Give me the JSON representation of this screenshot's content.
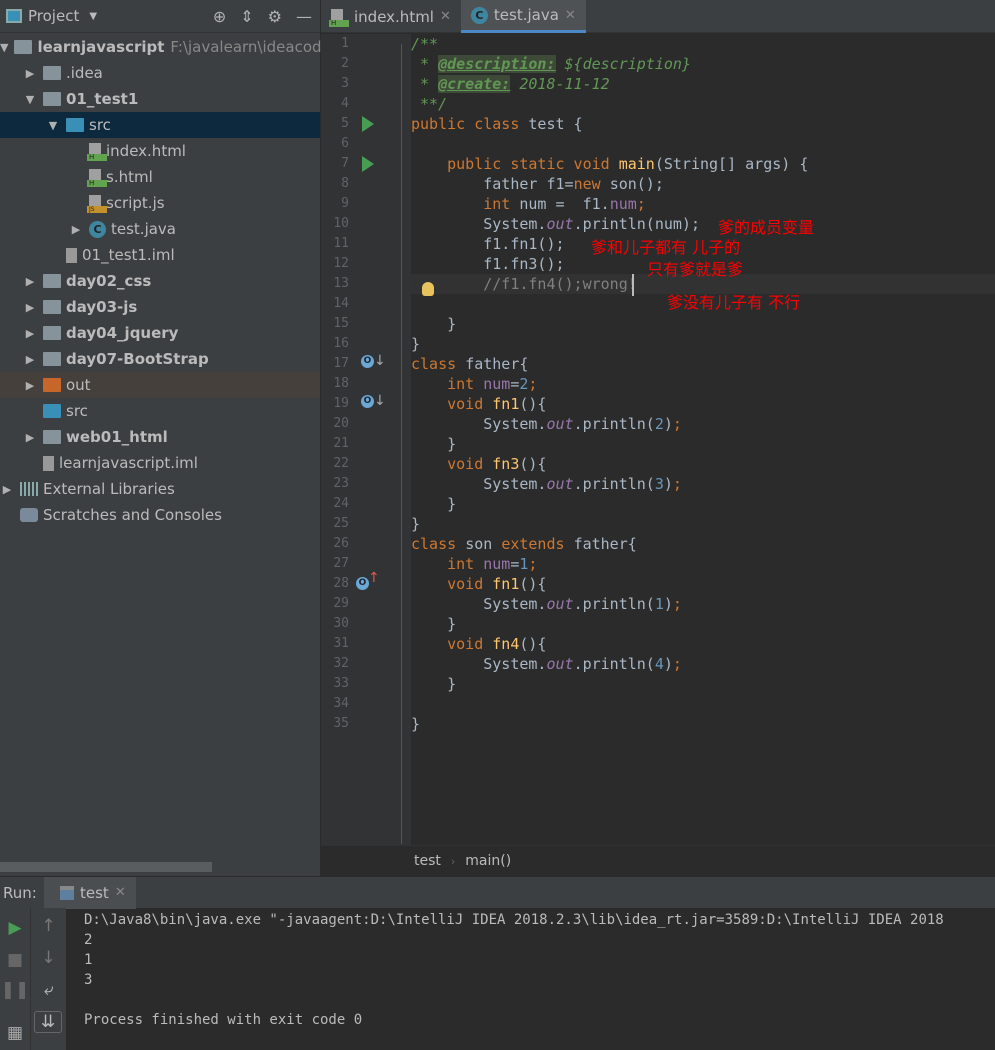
{
  "project_panel": {
    "title": "Project",
    "tree": [
      {
        "label": "learnjavascript",
        "path": "F:\\javalearn\\ideacode\\",
        "icon": "module-folder",
        "expanded": true
      },
      {
        "label": ".idea",
        "icon": "folder",
        "expanded": false
      },
      {
        "label": "01_test1",
        "icon": "module-folder",
        "expanded": true
      },
      {
        "label": "src",
        "icon": "source-folder",
        "expanded": true,
        "selected": true
      },
      {
        "label": "index.html",
        "icon": "html-file"
      },
      {
        "label": "s.html",
        "icon": "html-file"
      },
      {
        "label": "script.js",
        "icon": "js-file"
      },
      {
        "label": "test.java",
        "icon": "java-class",
        "expanded": false
      },
      {
        "label": "01_test1.iml",
        "icon": "iml-file"
      },
      {
        "label": "day02_css",
        "icon": "folder",
        "expanded": false
      },
      {
        "label": "day03-js",
        "icon": "folder",
        "expanded": false
      },
      {
        "label": "day04_jquery",
        "icon": "folder",
        "expanded": false
      },
      {
        "label": "day07-BootStrap",
        "icon": "folder",
        "expanded": false
      },
      {
        "label": "out",
        "icon": "excluded-folder",
        "expanded": false
      },
      {
        "label": "src",
        "icon": "source-folder"
      },
      {
        "label": "web01_html",
        "icon": "folder",
        "expanded": false
      },
      {
        "label": "learnjavascript.iml",
        "icon": "iml-file"
      },
      {
        "label": "External Libraries",
        "icon": "library",
        "expanded": false
      },
      {
        "label": "Scratches and Consoles",
        "icon": "scratches"
      }
    ]
  },
  "editor_tabs": [
    {
      "label": "index.html",
      "active": false
    },
    {
      "label": "test.java",
      "active": true
    }
  ],
  "code_lines": [
    [
      [
        "/**",
        "doc"
      ]
    ],
    [
      [
        " * ",
        "doc"
      ],
      [
        "@description:",
        "tag"
      ],
      [
        " ${description}",
        "doc"
      ]
    ],
    [
      [
        " * ",
        "doc"
      ],
      [
        "@create:",
        "tag"
      ],
      [
        " 2018-11-12",
        "doc"
      ]
    ],
    [
      [
        " **/",
        "doc"
      ]
    ],
    [
      [
        "public class ",
        "kw"
      ],
      [
        "test {",
        ""
      ]
    ],
    [],
    [
      [
        "    public static void ",
        "kw"
      ],
      [
        "main",
        "fn"
      ],
      [
        "(String[] args) {",
        ""
      ]
    ],
    [
      [
        "        father f1=",
        ""
      ],
      [
        "new ",
        "kw"
      ],
      [
        "son();",
        ""
      ]
    ],
    [
      [
        "        int ",
        "kw"
      ],
      [
        "num =  f1.",
        ""
      ],
      [
        "num",
        "fd"
      ],
      [
        ";",
        "kw"
      ]
    ],
    [
      [
        "        System.",
        ""
      ],
      [
        "out",
        "it"
      ],
      [
        ".println(num);",
        ""
      ]
    ],
    [
      [
        "        f1.fn1();",
        ""
      ]
    ],
    [
      [
        "        f1.fn3();",
        ""
      ]
    ],
    [
      [
        "        //f1.fn4();wrong!",
        "cm"
      ]
    ],
    [],
    [
      [
        "    }",
        ""
      ]
    ],
    [
      [
        "}",
        ""
      ]
    ],
    [
      [
        "class ",
        "kw"
      ],
      [
        "father{",
        ""
      ]
    ],
    [
      [
        "    int ",
        "kw"
      ],
      [
        "num",
        "fd"
      ],
      [
        "=",
        ""
      ],
      [
        "2",
        "num"
      ],
      [
        ";",
        "kw"
      ]
    ],
    [
      [
        "    void ",
        "kw"
      ],
      [
        "fn1",
        "fn"
      ],
      [
        "(){",
        ""
      ]
    ],
    [
      [
        "        System.",
        ""
      ],
      [
        "out",
        "it"
      ],
      [
        ".println(",
        ""
      ],
      [
        "2",
        "num"
      ],
      [
        ")",
        ""
      ],
      [
        ";",
        "kw"
      ]
    ],
    [
      [
        "    }",
        ""
      ]
    ],
    [
      [
        "    void ",
        "kw"
      ],
      [
        "fn3",
        "fn"
      ],
      [
        "(){",
        ""
      ]
    ],
    [
      [
        "        System.",
        ""
      ],
      [
        "out",
        "it"
      ],
      [
        ".println(",
        ""
      ],
      [
        "3",
        "num"
      ],
      [
        ")",
        ""
      ],
      [
        ";",
        "kw"
      ]
    ],
    [
      [
        "    }",
        ""
      ]
    ],
    [
      [
        "}",
        ""
      ]
    ],
    [
      [
        "class ",
        "kw"
      ],
      [
        "son ",
        ""
      ],
      [
        "extends ",
        "kw"
      ],
      [
        "father{",
        ""
      ]
    ],
    [
      [
        "    int ",
        "kw"
      ],
      [
        "num",
        "fd"
      ],
      [
        "=",
        ""
      ],
      [
        "1",
        "num"
      ],
      [
        ";",
        "kw"
      ]
    ],
    [
      [
        "    void ",
        "kw"
      ],
      [
        "fn1",
        "fn"
      ],
      [
        "(){",
        ""
      ]
    ],
    [
      [
        "        System.",
        ""
      ],
      [
        "out",
        "it"
      ],
      [
        ".println(",
        ""
      ],
      [
        "1",
        "num"
      ],
      [
        ")",
        ""
      ],
      [
        ";",
        "kw"
      ]
    ],
    [
      [
        "    }",
        ""
      ]
    ],
    [
      [
        "    void ",
        "kw"
      ],
      [
        "fn4",
        "fn"
      ],
      [
        "(){",
        ""
      ]
    ],
    [
      [
        "        System.",
        ""
      ],
      [
        "out",
        "it"
      ],
      [
        ".println(",
        ""
      ],
      [
        "4",
        "num"
      ],
      [
        ")",
        ""
      ],
      [
        ";",
        "kw"
      ]
    ],
    [
      [
        "    }",
        ""
      ]
    ],
    [],
    [
      [
        "}",
        ""
      ]
    ]
  ],
  "annotations": {
    "line10": "爹的成员变量",
    "line11": "爹和儿子都有 儿子的",
    "line12": "只有爹就是爹",
    "line13": "爹没有儿子有 不行"
  },
  "breadcrumb": [
    "test",
    "main()"
  ],
  "run_panel": {
    "label": "Run:",
    "tab": "test",
    "output": [
      "D:\\Java8\\bin\\java.exe \"-javaagent:D:\\IntelliJ IDEA 2018.2.3\\lib\\idea_rt.jar=3589:D:\\IntelliJ IDEA 2018",
      "2",
      "1",
      "3",
      "",
      "Process finished with exit code 0"
    ]
  },
  "colors": {
    "keyword": "#cc7832",
    "function": "#ffc66d",
    "field": "#9876aa",
    "number": "#6897bb",
    "doc": "#629755",
    "annotation_text": "#ff0000",
    "selection": "#0d293e"
  }
}
